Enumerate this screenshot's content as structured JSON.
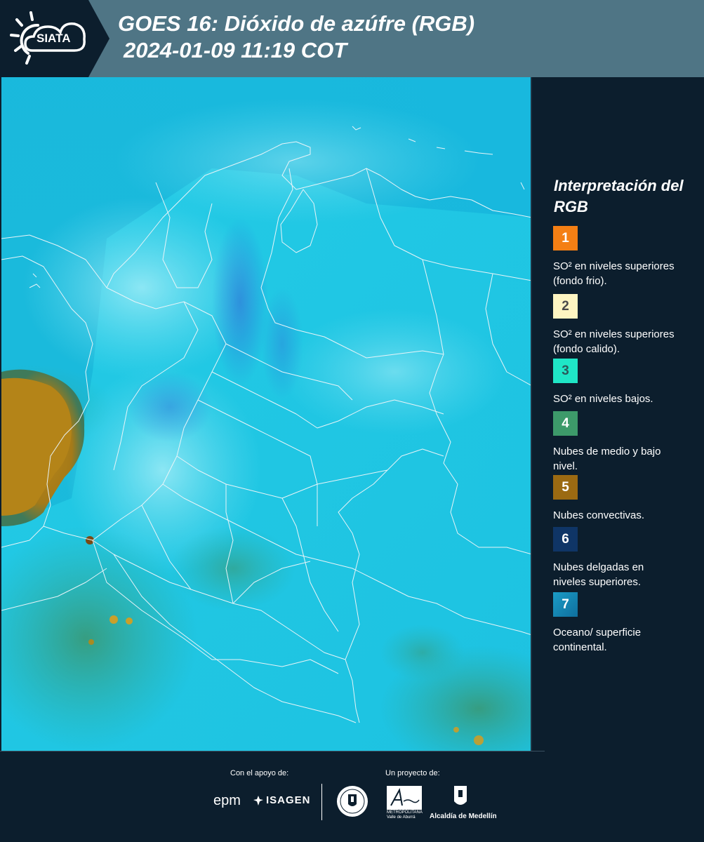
{
  "header": {
    "logo_text": "SIATA",
    "title_line1": "GOES 16: Dióxido de azúfre (RGB)",
    "title_line2": "2024-01-09 11:19 COT"
  },
  "legend": {
    "title": "Interpretación del RGB",
    "items": [
      {
        "number": "1",
        "label": "SO² en niveles superiores (fondo frio).",
        "color": "#f47f14",
        "text_color": "#ffffff"
      },
      {
        "number": "2",
        "label": "SO² en niveles superiores (fondo calido).",
        "color": "#fdf5c2",
        "text_color": "#4a4a4a"
      },
      {
        "number": "3",
        "label": "SO² en niveles bajos.",
        "color": "#1fe6c6",
        "text_color": "#2a5a5a"
      },
      {
        "number": "4",
        "label": "Nubes de medio y bajo nivel.",
        "color": "#3d9a6a",
        "text_color": "#ffffff"
      },
      {
        "number": "5",
        "label": "Nubes convectivas.",
        "color": "#9b6a12",
        "text_color": "#ffffff"
      },
      {
        "number": "6",
        "label": "Nubes delgadas en niveles superiores.",
        "color": "#0f3566",
        "text_color": "#ffffff"
      },
      {
        "number": "7",
        "label": "Oceano/ superficie continental.",
        "color": "#1b9cc6",
        "text_color": "#ffffff"
      }
    ]
  },
  "footer": {
    "support_label": "Con el apoyo de:",
    "project_label": "Un proyecto de:",
    "epm": "epm",
    "isagen": "ISAGEN",
    "area_name": "Área",
    "area_sub": "METROPOLITANA Valle de Aburrá",
    "alcaldia": "Alcaldía de Medellín"
  },
  "colors": {
    "header_bg": "#4f7585",
    "dark_bg": "#0c1e2d",
    "map_cyan": "#1fc2e0",
    "map_deep": "#0fa8d4",
    "convective": "#b48418",
    "midcloud": "#2f8f6e"
  }
}
